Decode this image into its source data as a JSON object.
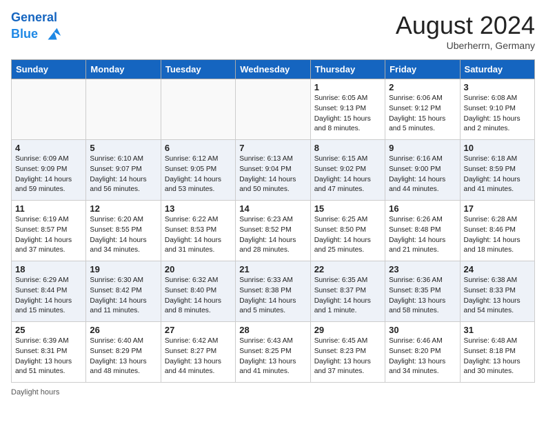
{
  "header": {
    "logo_line1": "General",
    "logo_line2": "Blue",
    "month": "August 2024",
    "location": "Uberherrn, Germany"
  },
  "weekdays": [
    "Sunday",
    "Monday",
    "Tuesday",
    "Wednesday",
    "Thursday",
    "Friday",
    "Saturday"
  ],
  "weeks": [
    [
      {
        "day": "",
        "info": ""
      },
      {
        "day": "",
        "info": ""
      },
      {
        "day": "",
        "info": ""
      },
      {
        "day": "",
        "info": ""
      },
      {
        "day": "1",
        "info": "Sunrise: 6:05 AM\nSunset: 9:13 PM\nDaylight: 15 hours and 8 minutes."
      },
      {
        "day": "2",
        "info": "Sunrise: 6:06 AM\nSunset: 9:12 PM\nDaylight: 15 hours and 5 minutes."
      },
      {
        "day": "3",
        "info": "Sunrise: 6:08 AM\nSunset: 9:10 PM\nDaylight: 15 hours and 2 minutes."
      }
    ],
    [
      {
        "day": "4",
        "info": "Sunrise: 6:09 AM\nSunset: 9:09 PM\nDaylight: 14 hours and 59 minutes."
      },
      {
        "day": "5",
        "info": "Sunrise: 6:10 AM\nSunset: 9:07 PM\nDaylight: 14 hours and 56 minutes."
      },
      {
        "day": "6",
        "info": "Sunrise: 6:12 AM\nSunset: 9:05 PM\nDaylight: 14 hours and 53 minutes."
      },
      {
        "day": "7",
        "info": "Sunrise: 6:13 AM\nSunset: 9:04 PM\nDaylight: 14 hours and 50 minutes."
      },
      {
        "day": "8",
        "info": "Sunrise: 6:15 AM\nSunset: 9:02 PM\nDaylight: 14 hours and 47 minutes."
      },
      {
        "day": "9",
        "info": "Sunrise: 6:16 AM\nSunset: 9:00 PM\nDaylight: 14 hours and 44 minutes."
      },
      {
        "day": "10",
        "info": "Sunrise: 6:18 AM\nSunset: 8:59 PM\nDaylight: 14 hours and 41 minutes."
      }
    ],
    [
      {
        "day": "11",
        "info": "Sunrise: 6:19 AM\nSunset: 8:57 PM\nDaylight: 14 hours and 37 minutes."
      },
      {
        "day": "12",
        "info": "Sunrise: 6:20 AM\nSunset: 8:55 PM\nDaylight: 14 hours and 34 minutes."
      },
      {
        "day": "13",
        "info": "Sunrise: 6:22 AM\nSunset: 8:53 PM\nDaylight: 14 hours and 31 minutes."
      },
      {
        "day": "14",
        "info": "Sunrise: 6:23 AM\nSunset: 8:52 PM\nDaylight: 14 hours and 28 minutes."
      },
      {
        "day": "15",
        "info": "Sunrise: 6:25 AM\nSunset: 8:50 PM\nDaylight: 14 hours and 25 minutes."
      },
      {
        "day": "16",
        "info": "Sunrise: 6:26 AM\nSunset: 8:48 PM\nDaylight: 14 hours and 21 minutes."
      },
      {
        "day": "17",
        "info": "Sunrise: 6:28 AM\nSunset: 8:46 PM\nDaylight: 14 hours and 18 minutes."
      }
    ],
    [
      {
        "day": "18",
        "info": "Sunrise: 6:29 AM\nSunset: 8:44 PM\nDaylight: 14 hours and 15 minutes."
      },
      {
        "day": "19",
        "info": "Sunrise: 6:30 AM\nSunset: 8:42 PM\nDaylight: 14 hours and 11 minutes."
      },
      {
        "day": "20",
        "info": "Sunrise: 6:32 AM\nSunset: 8:40 PM\nDaylight: 14 hours and 8 minutes."
      },
      {
        "day": "21",
        "info": "Sunrise: 6:33 AM\nSunset: 8:38 PM\nDaylight: 14 hours and 5 minutes."
      },
      {
        "day": "22",
        "info": "Sunrise: 6:35 AM\nSunset: 8:37 PM\nDaylight: 14 hours and 1 minute."
      },
      {
        "day": "23",
        "info": "Sunrise: 6:36 AM\nSunset: 8:35 PM\nDaylight: 13 hours and 58 minutes."
      },
      {
        "day": "24",
        "info": "Sunrise: 6:38 AM\nSunset: 8:33 PM\nDaylight: 13 hours and 54 minutes."
      }
    ],
    [
      {
        "day": "25",
        "info": "Sunrise: 6:39 AM\nSunset: 8:31 PM\nDaylight: 13 hours and 51 minutes."
      },
      {
        "day": "26",
        "info": "Sunrise: 6:40 AM\nSunset: 8:29 PM\nDaylight: 13 hours and 48 minutes."
      },
      {
        "day": "27",
        "info": "Sunrise: 6:42 AM\nSunset: 8:27 PM\nDaylight: 13 hours and 44 minutes."
      },
      {
        "day": "28",
        "info": "Sunrise: 6:43 AM\nSunset: 8:25 PM\nDaylight: 13 hours and 41 minutes."
      },
      {
        "day": "29",
        "info": "Sunrise: 6:45 AM\nSunset: 8:23 PM\nDaylight: 13 hours and 37 minutes."
      },
      {
        "day": "30",
        "info": "Sunrise: 6:46 AM\nSunset: 8:20 PM\nDaylight: 13 hours and 34 minutes."
      },
      {
        "day": "31",
        "info": "Sunrise: 6:48 AM\nSunset: 8:18 PM\nDaylight: 13 hours and 30 minutes."
      }
    ]
  ],
  "footer": {
    "label": "Daylight hours"
  }
}
